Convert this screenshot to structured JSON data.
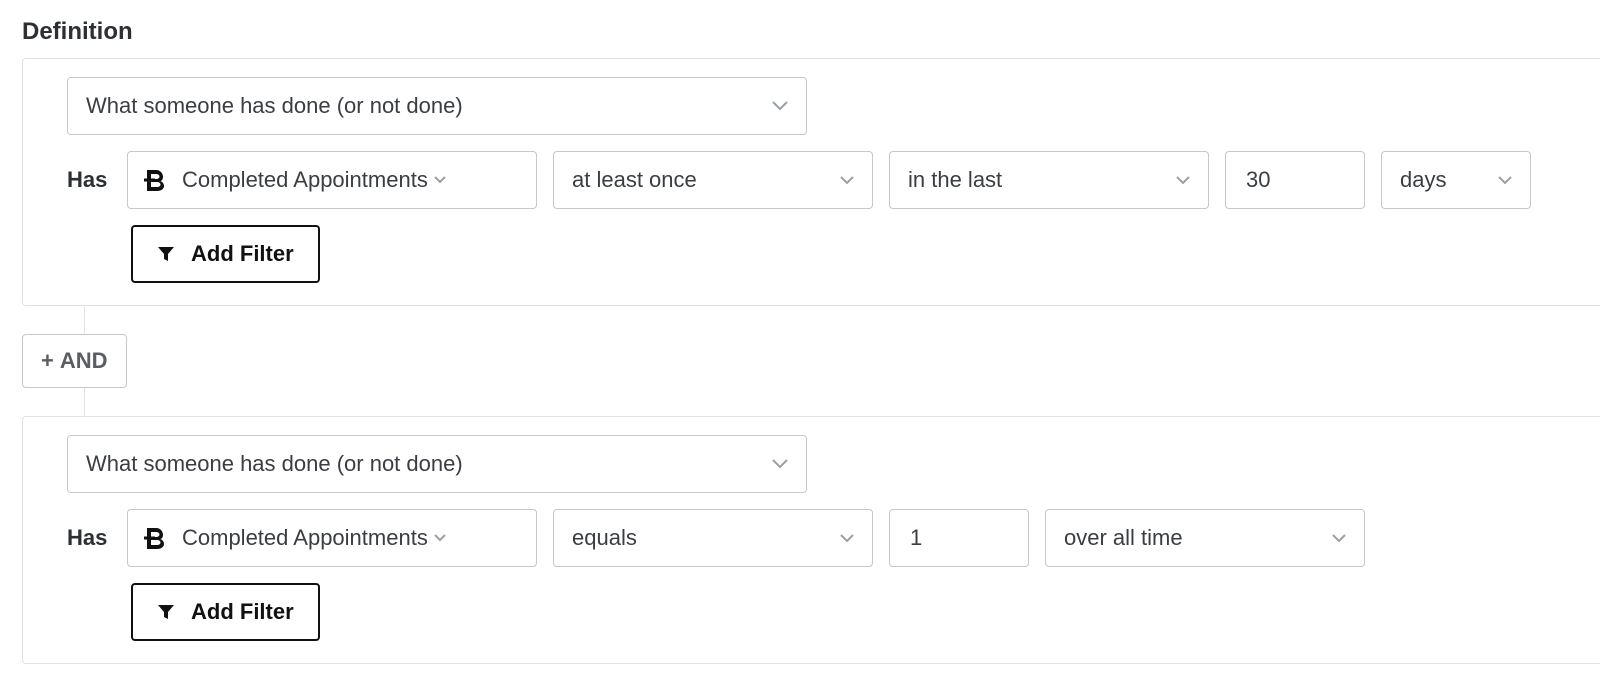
{
  "section_title": "Definition",
  "connector_label": "AND",
  "conditions": [
    {
      "type_selector": "What someone has done (or not done)",
      "has_label": "Has",
      "event": "Completed Appointments",
      "frequency": "at least once",
      "time_relation": "in the last",
      "number": "30",
      "unit": "days",
      "add_filter_label": "Add Filter"
    },
    {
      "type_selector": "What someone has done (or not done)",
      "has_label": "Has",
      "event": "Completed Appointments",
      "frequency": "equals",
      "number": "1",
      "time_relation": "over all time",
      "add_filter_label": "Add Filter"
    }
  ]
}
